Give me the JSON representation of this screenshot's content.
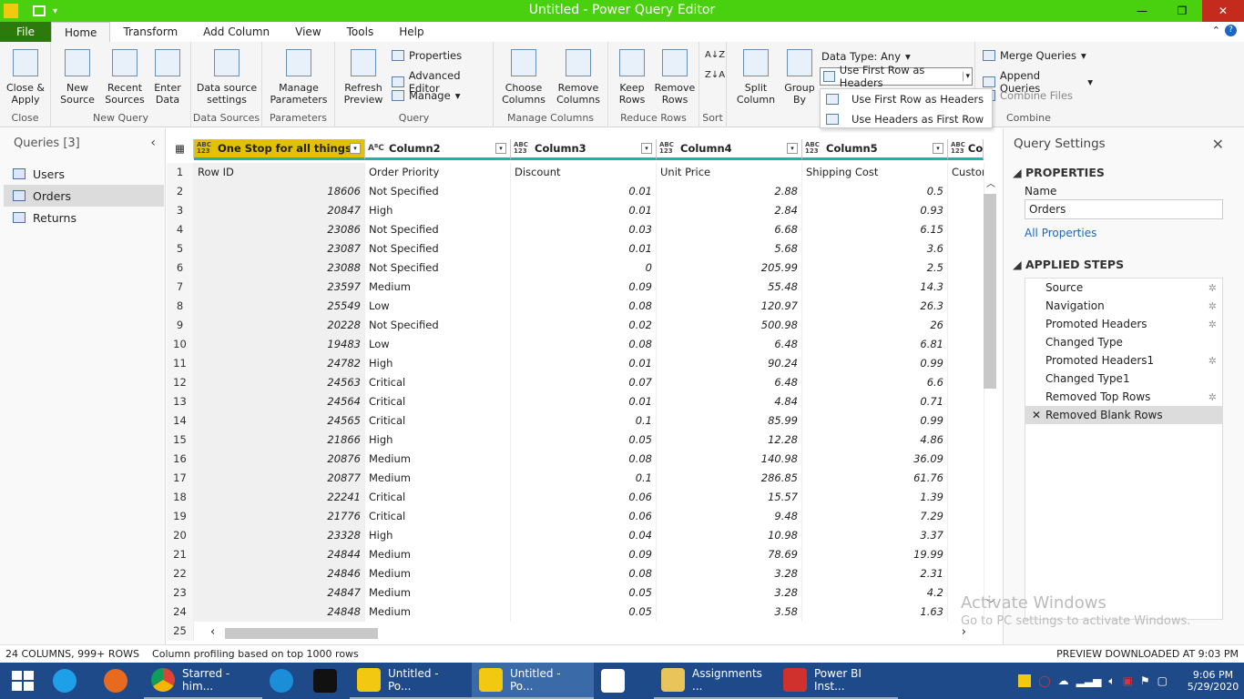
{
  "window": {
    "title": "Untitled - Power Query Editor"
  },
  "tabs": [
    "File",
    "Home",
    "Transform",
    "Add Column",
    "View",
    "Tools",
    "Help"
  ],
  "ribbon": {
    "groups": [
      "Close",
      "New Query",
      "Data Sources",
      "Parameters",
      "Query",
      "Manage Columns",
      "Reduce Rows",
      "Sort",
      "Combine"
    ],
    "close_apply": "Close &\nApply",
    "new_source": "New\nSource",
    "recent_sources": "Recent\nSources",
    "enter_data": "Enter\nData",
    "data_source_settings": "Data source\nsettings",
    "manage_parameters": "Manage\nParameters",
    "refresh_preview": "Refresh\nPreview",
    "properties": "Properties",
    "advanced_editor": "Advanced Editor",
    "manage": "Manage",
    "choose_columns": "Choose\nColumns",
    "remove_columns": "Remove\nColumns",
    "keep_rows": "Keep\nRows",
    "remove_rows": "Remove\nRows",
    "split_column": "Split\nColumn",
    "group_by": "Group\nBy",
    "data_type": "Data Type: Any",
    "use_first_row": "Use First Row as Headers",
    "merge_queries": "Merge Queries",
    "append_queries": "Append Queries",
    "combine_files": "Combine Files"
  },
  "dropdown": {
    "items": [
      "Use First Row as Headers",
      "Use Headers as First Row"
    ]
  },
  "queries": {
    "title": "Queries [3]",
    "items": [
      "Users",
      "Orders",
      "Returns"
    ],
    "selected": "Orders"
  },
  "columns": [
    "One Stop for all things",
    "Column2",
    "Column3",
    "Column4",
    "Column5",
    "Colum"
  ],
  "header_row": [
    "Row ID",
    "Order Priority",
    "Discount",
    "Unit Price",
    "Shipping Cost",
    "Custom"
  ],
  "rows": [
    [
      "18606",
      "Not Specified",
      "0.01",
      "2.88",
      "0.5"
    ],
    [
      "20847",
      "High",
      "0.01",
      "2.84",
      "0.93"
    ],
    [
      "23086",
      "Not Specified",
      "0.03",
      "6.68",
      "6.15"
    ],
    [
      "23087",
      "Not Specified",
      "0.01",
      "5.68",
      "3.6"
    ],
    [
      "23088",
      "Not Specified",
      "0",
      "205.99",
      "2.5"
    ],
    [
      "23597",
      "Medium",
      "0.09",
      "55.48",
      "14.3"
    ],
    [
      "25549",
      "Low",
      "0.08",
      "120.97",
      "26.3"
    ],
    [
      "20228",
      "Not Specified",
      "0.02",
      "500.98",
      "26"
    ],
    [
      "19483",
      "Low",
      "0.08",
      "6.48",
      "6.81"
    ],
    [
      "24782",
      "High",
      "0.01",
      "90.24",
      "0.99"
    ],
    [
      "24563",
      "Critical",
      "0.07",
      "6.48",
      "6.6"
    ],
    [
      "24564",
      "Critical",
      "0.01",
      "4.84",
      "0.71"
    ],
    [
      "24565",
      "Critical",
      "0.1",
      "85.99",
      "0.99"
    ],
    [
      "21866",
      "High",
      "0.05",
      "12.28",
      "4.86"
    ],
    [
      "20876",
      "Medium",
      "0.08",
      "140.98",
      "36.09"
    ],
    [
      "20877",
      "Medium",
      "0.1",
      "286.85",
      "61.76"
    ],
    [
      "22241",
      "Critical",
      "0.06",
      "15.57",
      "1.39"
    ],
    [
      "21776",
      "Critical",
      "0.06",
      "9.48",
      "7.29"
    ],
    [
      "23328",
      "High",
      "0.04",
      "10.98",
      "3.37"
    ],
    [
      "24844",
      "Medium",
      "0.09",
      "78.69",
      "19.99"
    ],
    [
      "24846",
      "Medium",
      "0.08",
      "3.28",
      "2.31"
    ],
    [
      "24847",
      "Medium",
      "0.05",
      "3.28",
      "4.2"
    ],
    [
      "24848",
      "Medium",
      "0.05",
      "3.58",
      "1.63"
    ]
  ],
  "settings": {
    "title": "Query Settings",
    "properties_label": "PROPERTIES",
    "name_label": "Name",
    "name_value": "Orders",
    "all_properties": "All Properties",
    "applied_steps_label": "APPLIED STEPS",
    "steps": [
      {
        "name": "Source",
        "gear": true
      },
      {
        "name": "Navigation",
        "gear": true
      },
      {
        "name": "Promoted Headers",
        "gear": true
      },
      {
        "name": "Changed Type",
        "gear": false
      },
      {
        "name": "Promoted Headers1",
        "gear": true
      },
      {
        "name": "Changed Type1",
        "gear": false
      },
      {
        "name": "Removed Top Rows",
        "gear": true
      },
      {
        "name": "Removed Blank Rows",
        "gear": false,
        "selected": true
      }
    ]
  },
  "watermark": {
    "line1": "Activate Windows",
    "line2": "Go to PC settings to activate Windows."
  },
  "status": {
    "left": "24 COLUMNS, 999+ ROWS",
    "profiling": "Column profiling based on top 1000 rows",
    "right": "PREVIEW DOWNLOADED AT 9:03 PM"
  },
  "taskbar": {
    "items": [
      "Starred - him...",
      "Untitled - Po...",
      "Untitled - Po...",
      "Assignments ...",
      "Power BI Inst..."
    ],
    "time": "9:06 PM",
    "date": "5/29/2020"
  }
}
